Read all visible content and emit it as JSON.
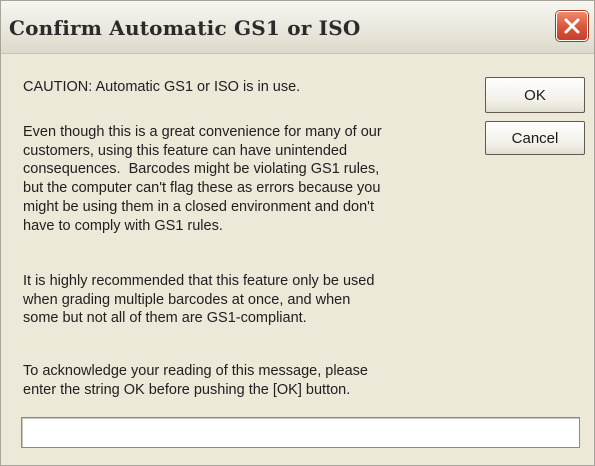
{
  "dialog": {
    "title": "Confirm Automatic GS1 or ISO",
    "caution": "CAUTION: Automatic GS1 or ISO is in use.",
    "paragraph1_lines": [
      "Even though this is a great convenience for many of our",
      "customers, using this feature can have unintended",
      "consequences.  Barcodes might be violating GS1 rules,",
      "but the computer can't flag these as errors because you",
      "might be using them in a closed environment and don't",
      "have to comply with GS1 rules."
    ],
    "paragraph2_lines": [
      "It is highly recommended that this feature only be used",
      "when grading multiple barcodes at once, and when",
      "some but not all of them are GS1-compliant."
    ],
    "paragraph3_lines": [
      "To acknowledge your reading of this message, please",
      "enter the string OK before pushing the [OK] button."
    ],
    "ok_label": "OK",
    "cancel_label": "Cancel",
    "input_value": ""
  },
  "icons": {
    "close": "close-icon"
  },
  "colors": {
    "dialog_background": "#ece9d8",
    "close_button": "#d8553a"
  }
}
